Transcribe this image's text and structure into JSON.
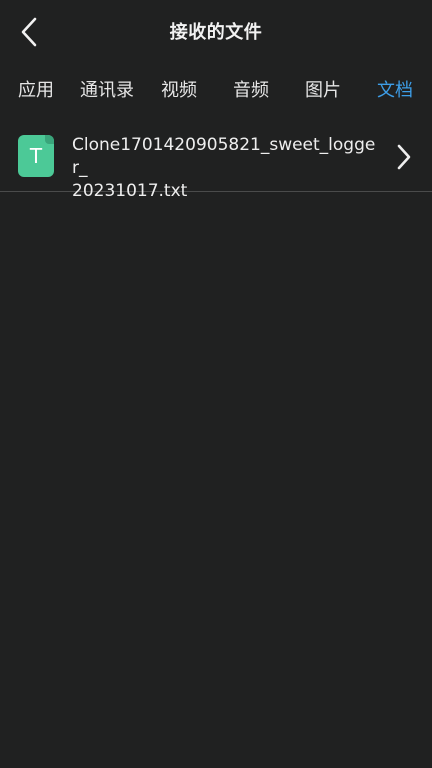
{
  "header": {
    "title": "接收的文件",
    "back_icon": "chevron-left-icon"
  },
  "tabs": [
    {
      "label": "应用",
      "active": false
    },
    {
      "label": "通讯录",
      "active": false
    },
    {
      "label": "视频",
      "active": false
    },
    {
      "label": "音频",
      "active": false
    },
    {
      "label": "图片",
      "active": false
    },
    {
      "label": "文档",
      "active": true
    }
  ],
  "files": [
    {
      "icon_letter": "T",
      "icon": "text-file-icon",
      "name_line1": "Clone1701420905821_sweet_logger_",
      "name_line2": "20231017.txt",
      "action_icon": "chevron-right-icon"
    }
  ],
  "colors": {
    "background": "#202121",
    "accent": "#3d9ee8",
    "file_icon": "#4cc997"
  }
}
